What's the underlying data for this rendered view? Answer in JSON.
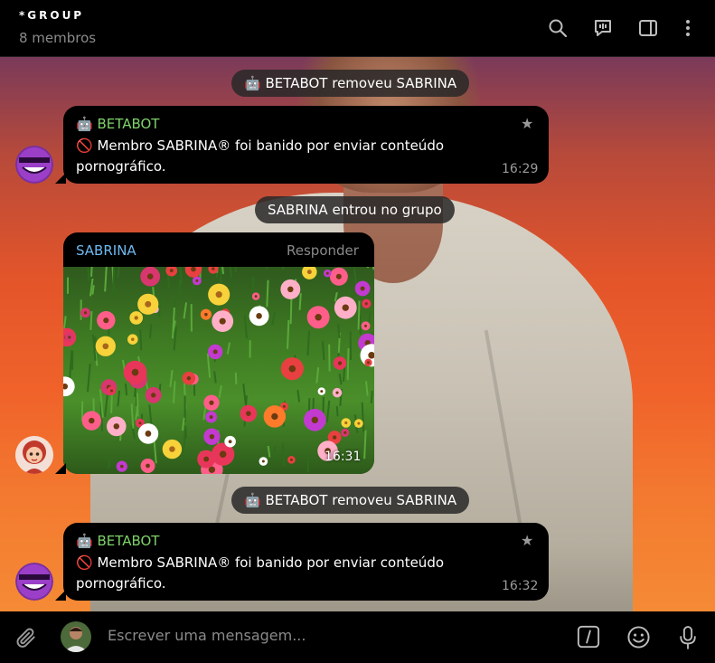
{
  "header": {
    "title": "*GROUP",
    "subtitle": "8 membros",
    "icons": [
      "search-icon",
      "voice-chat-icon",
      "sidebar-toggle-icon",
      "more-vert-icon"
    ]
  },
  "colors": {
    "bot_name": "#7fd36a",
    "user_name": "#6fb8ef",
    "bubble_bg": "#000000",
    "service_bg": "#282828"
  },
  "messages": [
    {
      "type": "service",
      "text": "🤖 BETABOT removeu SABRINA"
    },
    {
      "type": "bot",
      "sender": "🤖 BETABOT",
      "text_line1": "🚫 Membro SABRINA® foi banido por enviar conteúdo",
      "text_line2": "pornográfico.",
      "time": "16:29",
      "icon": "star-icon"
    },
    {
      "type": "service",
      "text": "SABRINA entrou no grupo"
    },
    {
      "type": "photo",
      "sender": "SABRINA",
      "reply_label": "Responder",
      "time": "16:31",
      "image": "flower-field-photo"
    },
    {
      "type": "service",
      "text": "🤖 BETABOT removeu SABRINA"
    },
    {
      "type": "bot",
      "sender": "🤖 BETABOT",
      "text_line1": "🚫 Membro SABRINA® foi banido por enviar conteúdo",
      "text_line2": "pornográfico.",
      "time": "16:32",
      "icon": "star-icon"
    }
  ],
  "input": {
    "placeholder": "Escrever uma mensagem...",
    "icons": [
      "paperclip-icon",
      "user-avatar",
      "bot-command-icon",
      "emoji-icon",
      "microphone-icon"
    ]
  }
}
